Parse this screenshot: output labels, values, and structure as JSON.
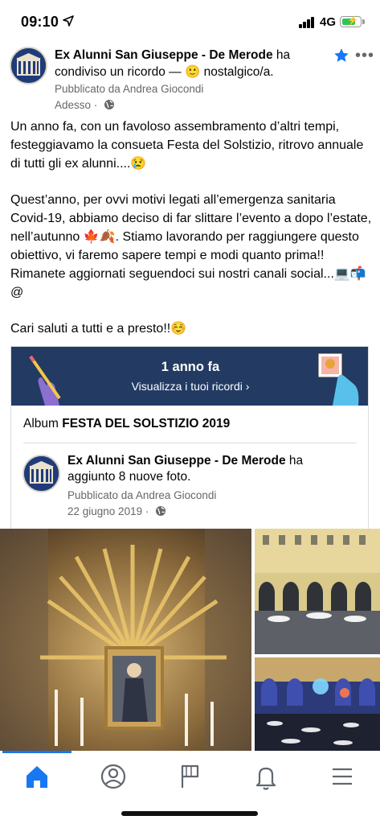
{
  "status_bar": {
    "time": "09:10",
    "network": "4G"
  },
  "post": {
    "page_name": "Ex Alunni San Giuseppe - De Merode",
    "action_text": " ha condiviso un ricordo — ",
    "feeling_text": " nostalgico/a.",
    "published_by": "Pubblicato da Andrea Giocondi",
    "time": "Adesso",
    "paragraph_1": "Un anno fa, con un favoloso assembramento d’altri tempi, festeggiavamo la consueta Festa del Solstizio, ritrovo annuale di tutti gli ex alunni....😢",
    "paragraph_2": "Quest’anno, per ovvi motivi legati all’emergenza sanitaria Covid-19, abbiamo deciso di far slittare l’evento a dopo l’estate, nell’autunno 🍁🍂. Stiamo lavorando per raggiungere questo obiettivo, vi faremo sapere tempi e modi quanto prima!! Rimanete aggiornati seguendoci sui nostri canali social...💻📬@",
    "paragraph_3": "Cari saluti a tutti e a presto!!☺️"
  },
  "memory": {
    "title": "1 anno fa",
    "link": "Visualizza i tuoi ricordi"
  },
  "album": {
    "prefix": "Album ",
    "name": "FESTA DEL SOLSTIZIO 2019"
  },
  "shared_post": {
    "page_name": "Ex Alunni San Giuseppe - De Merode",
    "action_text": " ha aggiunto 8 nuove foto.",
    "published_by": "Pubblicato da Andrea Giocondi",
    "date": "22 giugno 2019"
  },
  "tabs": [
    {
      "icon": "home-icon",
      "active": true
    },
    {
      "icon": "profile-icon",
      "active": false
    },
    {
      "icon": "flag-icon",
      "active": false
    },
    {
      "icon": "bell-icon",
      "active": false
    },
    {
      "icon": "menu-icon",
      "active": false
    }
  ],
  "colors": {
    "brand_blue": "#1877f2",
    "banner_navy": "#233b63",
    "meta_gray": "#65676b"
  }
}
